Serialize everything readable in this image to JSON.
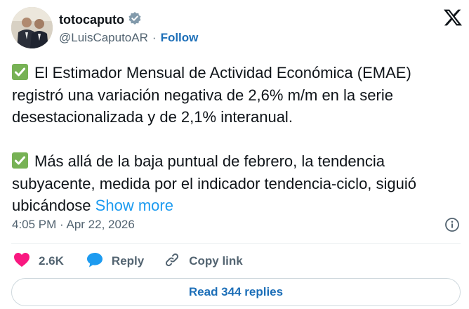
{
  "author": {
    "display_name": "totocaputo",
    "verified_icon": "verified-badge-icon",
    "handle": "@LuisCaputoAR",
    "separator": "·",
    "follow_label": "Follow"
  },
  "brand_logo": "x-logo-icon",
  "tweet": {
    "paragraphs": [
      {
        "icon": "check-mark-button-emoji",
        "text": "El Estimador Mensual de Actividad Económica (EMAE) registró una variación negativa de 2,6% m/m en la serie desestacionalizada y de 2,1% interanual."
      },
      {
        "icon": "check-mark-button-emoji",
        "text": "Más allá de la baja puntual de febrero, la tendencia subyacente, medida por el indicador tendencia-ciclo, siguió ubicándose",
        "show_more": "Show more"
      }
    ],
    "timestamp": "4:05 PM · Apr 22, 2026",
    "info_icon": "info-icon"
  },
  "actions": {
    "like": {
      "icon": "heart-icon",
      "count": "2.6K"
    },
    "reply": {
      "icon": "reply-bubble-icon",
      "label": "Reply"
    },
    "copy": {
      "icon": "link-icon",
      "label": "Copy link"
    }
  },
  "read_replies_label": "Read 344 replies",
  "colors": {
    "link_blue": "#1d9bf0",
    "follow_blue": "#1d6fb8",
    "heart_pink": "#f91880",
    "check_green": "#77b255",
    "muted_gray": "#536471"
  }
}
